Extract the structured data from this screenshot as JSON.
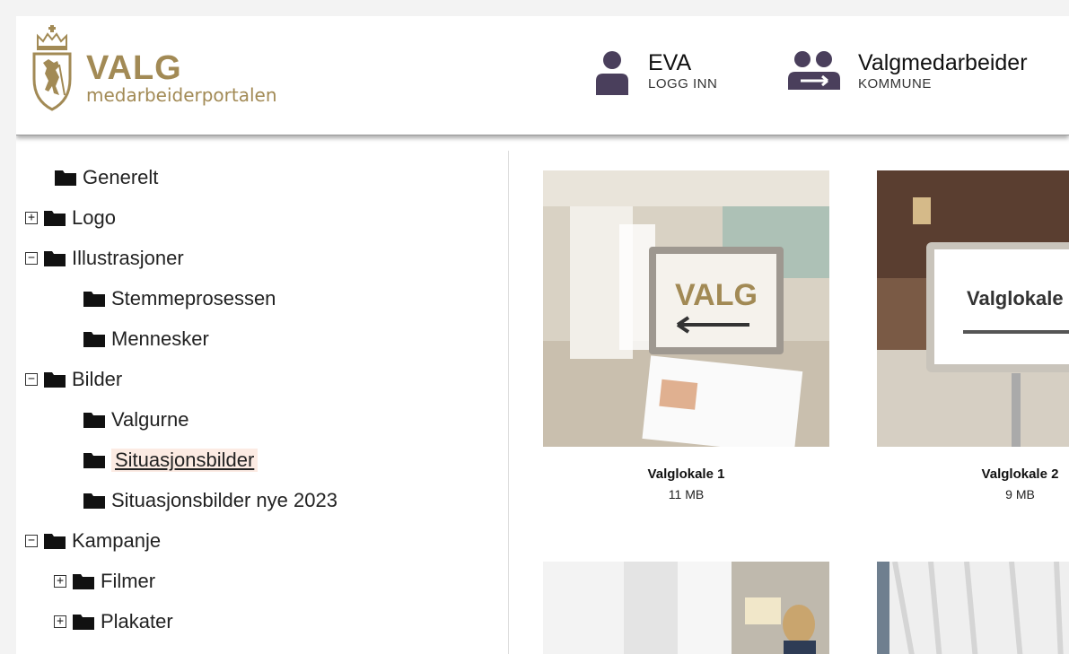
{
  "header": {
    "logo_title": "VALG",
    "logo_subtitle": "medarbeiderportalen",
    "user": {
      "name": "EVA",
      "action": "LOGG INN",
      "icon": "person-icon"
    },
    "role": {
      "name": "Valgmedarbeider",
      "sub": "KOMMUNE",
      "icon": "group-swap-icon"
    },
    "brand_color": "#a28a55",
    "icon_color": "#4a3f5c"
  },
  "sidebar": {
    "items": [
      {
        "label": "Generelt",
        "toggle": ""
      },
      {
        "label": "Logo",
        "toggle": "+"
      },
      {
        "label": "Illustrasjoner",
        "toggle": "−"
      },
      {
        "label": "Stemmeprosessen",
        "toggle": ""
      },
      {
        "label": "Mennesker",
        "toggle": ""
      },
      {
        "label": "Bilder",
        "toggle": "−"
      },
      {
        "label": "Valgurne",
        "toggle": ""
      },
      {
        "label": "Situasjonsbilder",
        "toggle": "",
        "active": true
      },
      {
        "label": "Situasjonsbilder nye 2023",
        "toggle": ""
      },
      {
        "label": "Kampanje",
        "toggle": "−"
      },
      {
        "label": "Filmer",
        "toggle": "+"
      },
      {
        "label": "Plakater",
        "toggle": "+"
      }
    ]
  },
  "gallery": {
    "cards": [
      {
        "caption": "Valglokale 1",
        "size": "11 MB"
      },
      {
        "caption": "Valglokale 2",
        "size": "9 MB"
      }
    ],
    "sign_text_1": "VALG",
    "sign_text_2": "Valglokale"
  }
}
